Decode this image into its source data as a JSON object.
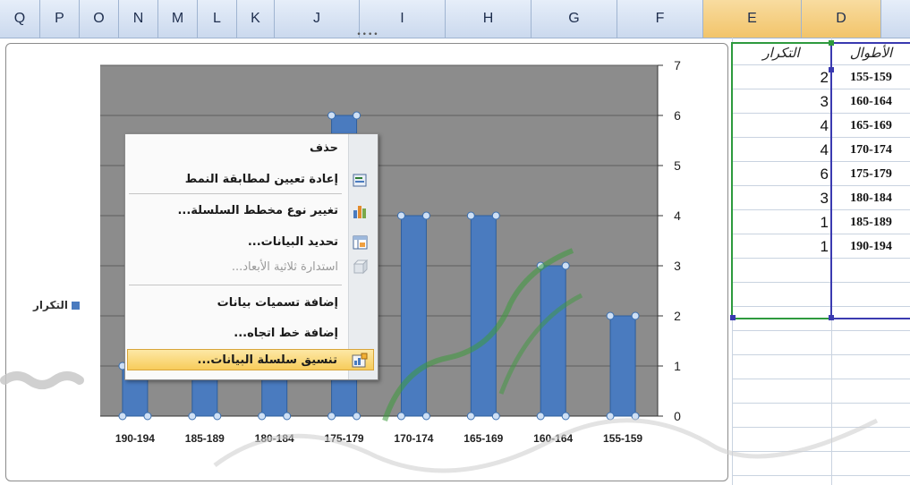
{
  "columns": [
    "Q",
    "P",
    "O",
    "N",
    "M",
    "L",
    "K",
    "J",
    "I",
    "H",
    "G",
    "F",
    "E",
    "D"
  ],
  "sheet": {
    "header_e": "التكرار",
    "header_d": "الأطوال",
    "rows": [
      {
        "length": "155-159",
        "freq": "2"
      },
      {
        "length": "160-164",
        "freq": "3"
      },
      {
        "length": "165-169",
        "freq": "4"
      },
      {
        "length": "170-174",
        "freq": "4"
      },
      {
        "length": "175-179",
        "freq": "6"
      },
      {
        "length": "180-184",
        "freq": "3"
      },
      {
        "length": "185-189",
        "freq": "1"
      },
      {
        "length": "190-194",
        "freq": "1"
      }
    ]
  },
  "chart_data": {
    "type": "bar",
    "categories": [
      "155-159",
      "160-164",
      "165-169",
      "170-174",
      "175-179",
      "180-184",
      "185-189",
      "190-194"
    ],
    "series": [
      {
        "name": "التكرار",
        "values": [
          2,
          3,
          4,
          4,
          6,
          3,
          1,
          1
        ],
        "color": "#4a7bbf"
      }
    ],
    "ylim": [
      0,
      7
    ],
    "yticks": [
      "0",
      "1",
      "2",
      "3",
      "4",
      "5",
      "6",
      "7"
    ],
    "grid": true,
    "plot_background": "#8c8c8c",
    "x_axis_direction": "right-to-left",
    "legend_position": "left"
  },
  "context_menu": {
    "items": [
      {
        "label": "حذف",
        "icon": "",
        "disabled": false
      },
      {
        "label": "إعادة تعيين لمطابقة النمط",
        "icon": "reset-style-icon",
        "disabled": false
      },
      {
        "label": "تغيير نوع مخطط السلسلة...",
        "icon": "chart-type-icon",
        "disabled": false
      },
      {
        "label": "تحديد البيانات...",
        "icon": "select-data-icon",
        "disabled": false
      },
      {
        "label": "استدارة ثلاثية الأبعاد...",
        "icon": "rotation-3d-icon",
        "disabled": true
      },
      {
        "label": "إضافة تسميات بيانات",
        "icon": "",
        "disabled": false
      },
      {
        "label": "إضافة خط اتجاه...",
        "icon": "",
        "disabled": false
      },
      {
        "label": "تنسيق سلسلة البيانات...",
        "icon": "format-series-icon",
        "disabled": false,
        "highlighted": true
      }
    ]
  },
  "colors": {
    "selection_green": "#2e9a3e",
    "selection_blue": "#3a3ab0",
    "bar": "#4a7bbf"
  }
}
